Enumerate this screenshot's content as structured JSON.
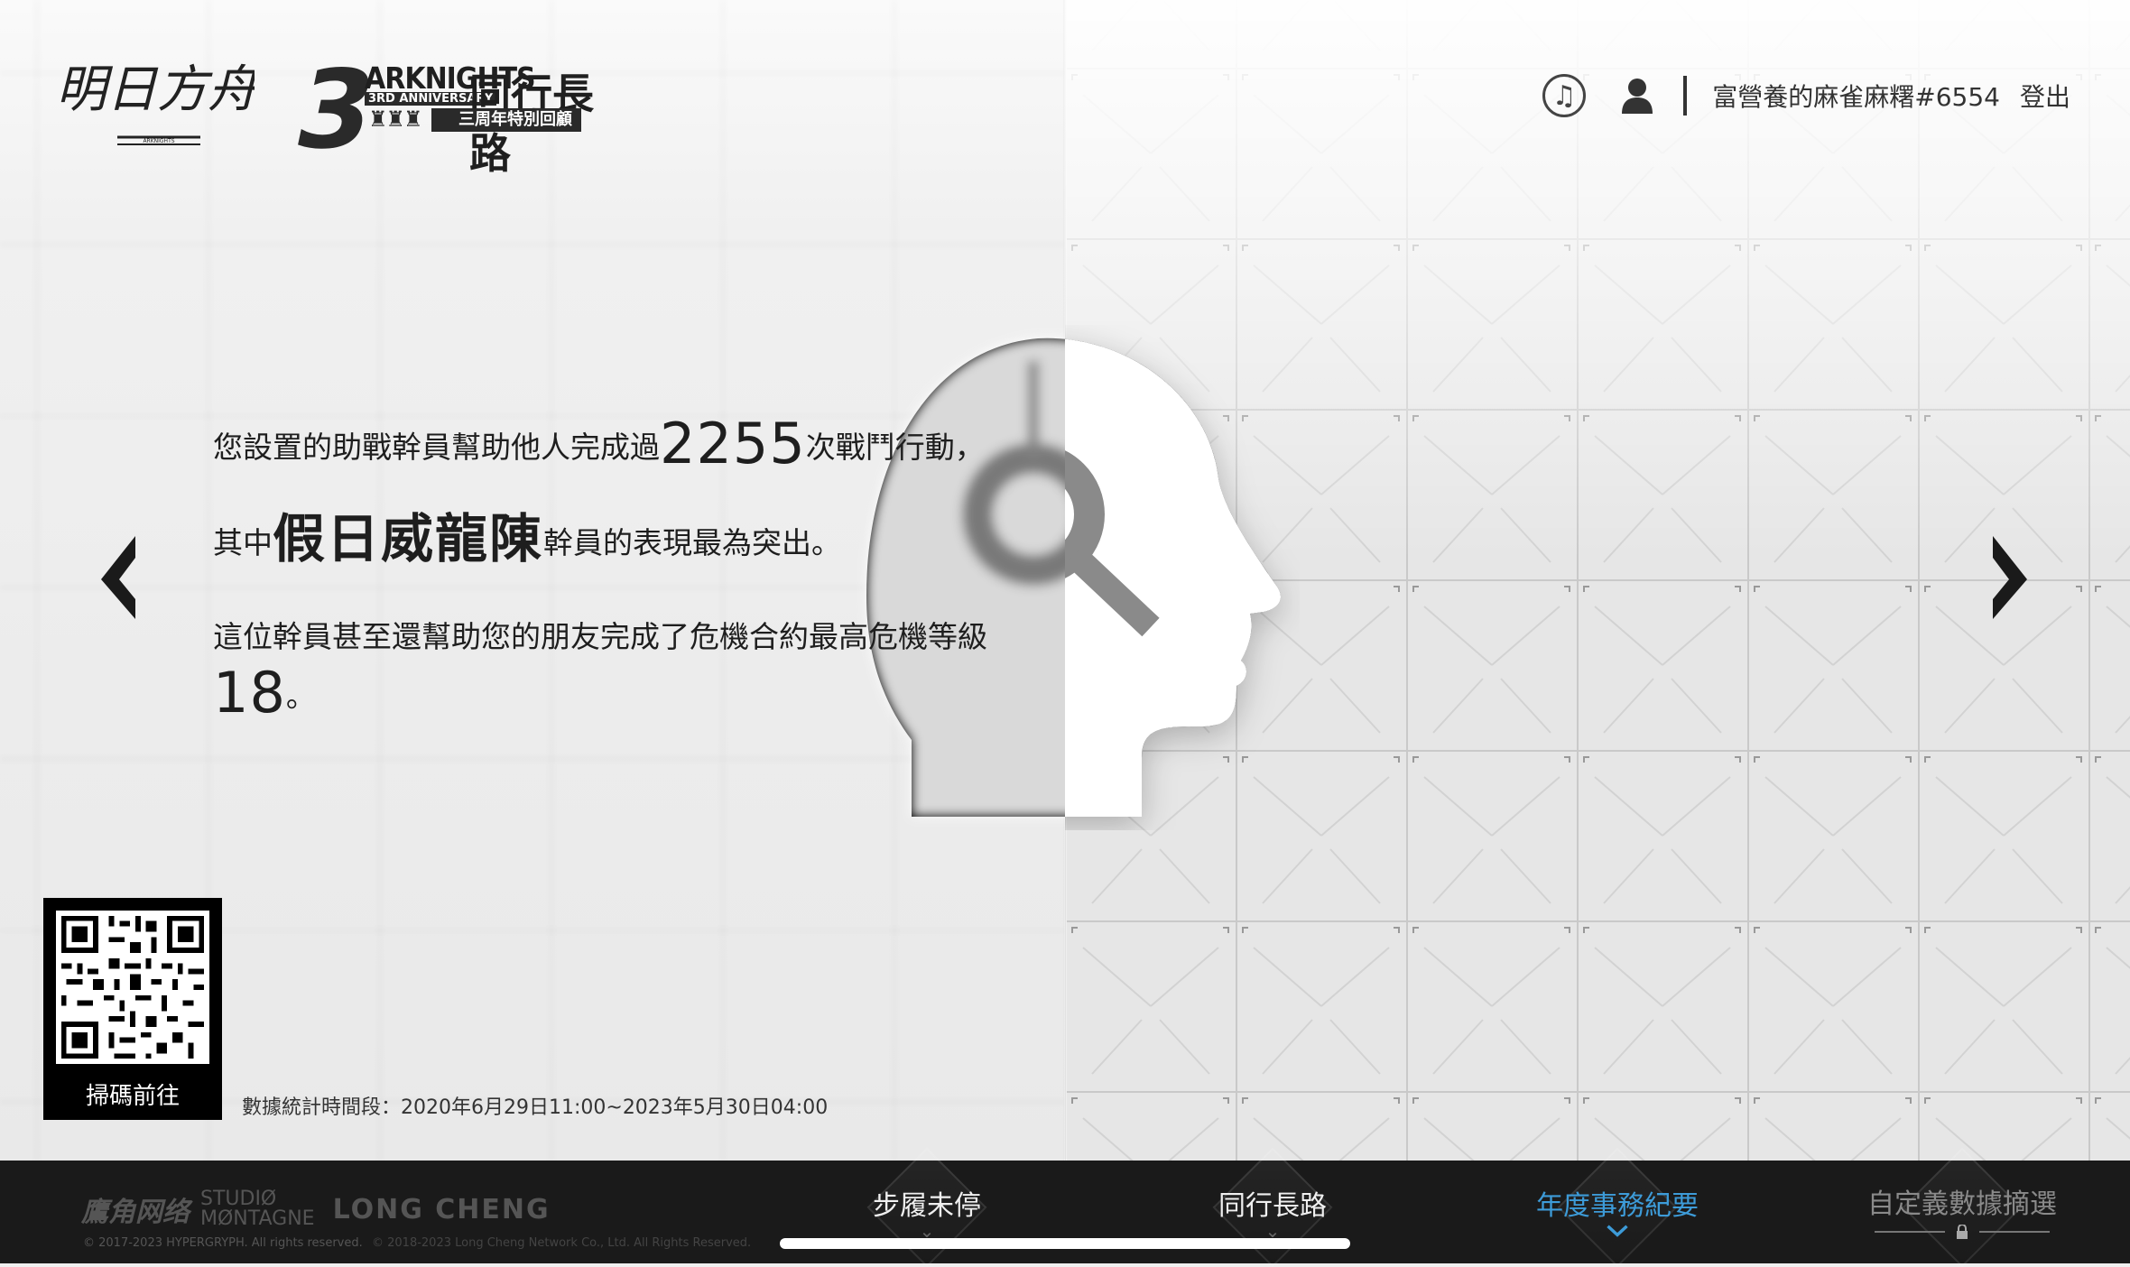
{
  "header": {
    "logo_text": "明日方舟",
    "logo_sub": "ARKNIGHTS",
    "anniversary": {
      "number": "3",
      "en_title": "ARKNIGHTS",
      "en_sub": "3RD ANNIVERSARY",
      "zh_title": "同行長路",
      "zh_sub": "三周年特別回顧"
    },
    "music_icon": "music-note-icon",
    "user_icon": "user-icon",
    "username": "富營養的麻雀麻糬#6554",
    "logout_label": "登出"
  },
  "content": {
    "line1_prefix": "您設置的助戰幹員幫助他人完成過",
    "line1_number": "2255",
    "line1_suffix": "次戰鬥行動，",
    "line2_prefix": "其中",
    "line2_name": "假日威龍陳",
    "line2_suffix": "幹員的表現最為突出。",
    "line3_text": "這位幹員甚至還幫助您的朋友完成了危機合約最高危機等級",
    "line3_number": "18",
    "line3_suffix": "。"
  },
  "qr": {
    "label": "掃碼前往"
  },
  "stat_period": "數據統計時間段：2020年6月29日11:00~2023年5月30日04:00",
  "footer": {
    "logo_hypergryph": "鷹角网络",
    "logo_studio_1": "STUDIØ",
    "logo_studio_2": "MØNTAGNE",
    "logo_longcheng": "LONG CHENG",
    "copyright_1": "© 2017-2023 HYPERGRYPH. All rights reserved.",
    "copyright_2": "© 2018-2023 Long Cheng Network Co., Ltd. All Rights Reserved.",
    "nav": [
      {
        "label": "步履未停",
        "state": "normal"
      },
      {
        "label": "同行長路",
        "state": "normal"
      },
      {
        "label": "年度事務紀要",
        "state": "active"
      },
      {
        "label": "自定義數據摘選",
        "state": "locked"
      }
    ]
  },
  "colors": {
    "accent": "#3d9bd8",
    "footer_bg": "#1a1a1a",
    "text": "#1e1e1e"
  }
}
